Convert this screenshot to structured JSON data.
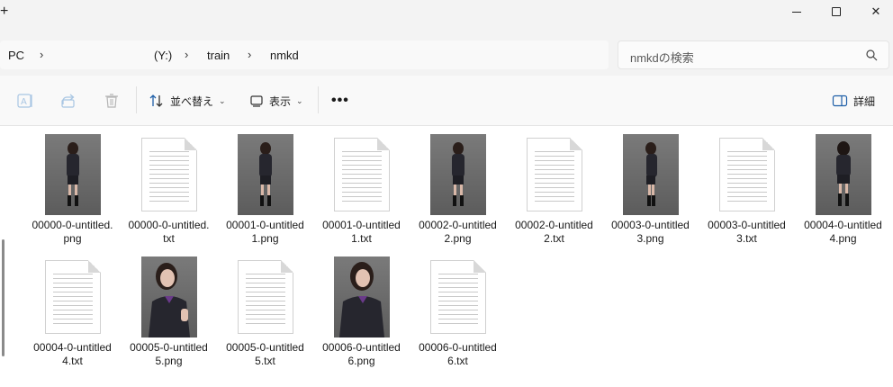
{
  "window": {
    "new_tab_glyph": "+",
    "minimize_label": "",
    "maximize_label": "",
    "close_label": "✕"
  },
  "address": {
    "crumbs": [
      "PC",
      "(Y:)",
      "train",
      "nmkd"
    ],
    "chevron": "›"
  },
  "search": {
    "placeholder": "nmkdの検索"
  },
  "commandbar": {
    "sort_label": "並べ替え",
    "view_label": "表示",
    "more_label": "•••",
    "details_label": "詳細"
  },
  "files": [
    {
      "name_line1": "00000-0-untitled.",
      "name_line2": "png",
      "kind": "image"
    },
    {
      "name_line1": "00000-0-untitled.",
      "name_line2": "txt",
      "kind": "text"
    },
    {
      "name_line1": "00001-0-untitled",
      "name_line2": "1.png",
      "kind": "image"
    },
    {
      "name_line1": "00001-0-untitled",
      "name_line2": "1.txt",
      "kind": "text"
    },
    {
      "name_line1": "00002-0-untitled",
      "name_line2": "2.png",
      "kind": "image"
    },
    {
      "name_line1": "00002-0-untitled",
      "name_line2": "2.txt",
      "kind": "text"
    },
    {
      "name_line1": "00003-0-untitled",
      "name_line2": "3.png",
      "kind": "image"
    },
    {
      "name_line1": "00003-0-untitled",
      "name_line2": "3.txt",
      "kind": "text"
    },
    {
      "name_line1": "00004-0-untitled",
      "name_line2": "4.png",
      "kind": "image"
    },
    {
      "name_line1": "00004-0-untitled",
      "name_line2": "4.txt",
      "kind": "text"
    },
    {
      "name_line1": "00005-0-untitled",
      "name_line2": "5.png",
      "kind": "image"
    },
    {
      "name_line1": "00005-0-untitled",
      "name_line2": "5.txt",
      "kind": "text"
    },
    {
      "name_line1": "00006-0-untitled",
      "name_line2": "6.png",
      "kind": "image"
    },
    {
      "name_line1": "00006-0-untitled",
      "name_line2": "6.txt",
      "kind": "text"
    }
  ],
  "colors": {
    "chrome": "#f3f3f3",
    "accent": "#005fb8"
  }
}
